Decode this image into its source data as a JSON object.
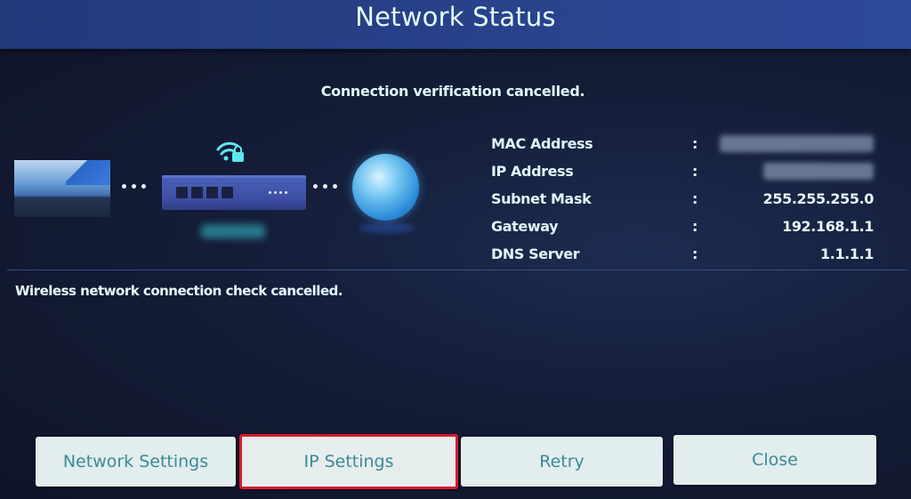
{
  "header": {
    "title": "Network Status"
  },
  "subtitle": "Connection verification cancelled.",
  "diagram": {
    "devices": [
      "tv-icon",
      "router-icon",
      "globe-icon"
    ],
    "router_badge_icon": "wifi-lock-icon",
    "router_label_obscured": true
  },
  "info": {
    "rows": [
      {
        "label": "MAC Address",
        "separator": ":",
        "value": "XX:XX:XX:XX:XX:XX",
        "obscured": true
      },
      {
        "label": "IP Address",
        "separator": ":",
        "value": "192.168.1.100",
        "obscured": true
      },
      {
        "label": "Subnet Mask",
        "separator": ":",
        "value": "255.255.255.0",
        "obscured": false
      },
      {
        "label": "Gateway",
        "separator": ":",
        "value": "192.168.1.1",
        "obscured": false
      },
      {
        "label": "DNS Server",
        "separator": ":",
        "value": "1.1.1.1",
        "obscured": false
      }
    ]
  },
  "status_message": "Wireless network connection check cancelled.",
  "buttons": {
    "network_settings": "Network Settings",
    "ip_settings": "IP Settings",
    "retry": "Retry",
    "close": "Close",
    "focused": "ip_settings"
  },
  "colors": {
    "header_bg": "#283f86",
    "focus_border": "#d81a2c",
    "button_text": "#3a8a98",
    "button_bg": "#e2eded"
  }
}
